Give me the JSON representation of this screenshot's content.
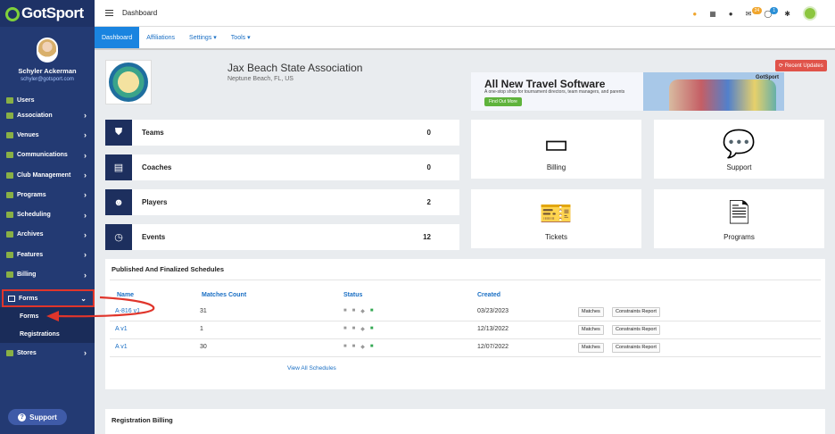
{
  "app": {
    "logo": "GotSport"
  },
  "user": {
    "name": "Schyler Ackerman",
    "email": "schyler@gotsport.com"
  },
  "sidebar": {
    "items": [
      {
        "label": "Users",
        "icon": "users-icon"
      },
      {
        "label": "Association",
        "icon": "sitemap-icon"
      },
      {
        "label": "Venues",
        "icon": "map-icon"
      },
      {
        "label": "Communications",
        "icon": "chat-icon"
      },
      {
        "label": "Club Management",
        "icon": "club-icon"
      },
      {
        "label": "Programs",
        "icon": "list-icon"
      },
      {
        "label": "Scheduling",
        "icon": "calendar-icon"
      },
      {
        "label": "Archives",
        "icon": "archive-icon"
      },
      {
        "label": "Features",
        "icon": "star-icon"
      },
      {
        "label": "Billing",
        "icon": "credit-card-icon"
      }
    ],
    "forms": {
      "label": "Forms",
      "sub": [
        "Forms",
        "Registrations"
      ]
    },
    "stores": {
      "label": "Stores"
    },
    "support": "Support"
  },
  "topbar": {
    "title": "Dashboard",
    "mail_count": "24",
    "chat_count": "1"
  },
  "subnav": {
    "tabs": [
      "Dashboard",
      "Affiliations",
      "Settings ▾",
      "Tools ▾"
    ]
  },
  "org": {
    "name": "Jax Beach State Association",
    "location": "Neptune Beach, FL, US",
    "updates_btn": "⟳ Recent Updates"
  },
  "banner": {
    "title": "All New Travel Software",
    "subtitle": "A one-stop shop for tournament directors, team managers, and parents",
    "button": "Find Out More",
    "logo": "GotSport"
  },
  "stats": [
    {
      "label": "Teams",
      "value": "0"
    },
    {
      "label": "Coaches",
      "value": "0"
    },
    {
      "label": "Players",
      "value": "2"
    },
    {
      "label": "Events",
      "value": "12"
    }
  ],
  "tiles": [
    {
      "label": "Billing"
    },
    {
      "label": "Support"
    },
    {
      "label": "Tickets"
    },
    {
      "label": "Programs"
    }
  ],
  "schedules": {
    "title": "Published And Finalized Schedules",
    "headers": [
      "Name",
      "Matches Count",
      "Status",
      "Created"
    ],
    "rows": [
      {
        "name": "A-816 v1",
        "count": "31",
        "created": "03/23/2023"
      },
      {
        "name": "A v1",
        "count": "1",
        "created": "12/13/2022"
      },
      {
        "name": "A v1",
        "count": "30",
        "created": "12/07/2022"
      }
    ],
    "btn_matches": "Matches",
    "btn_constraints": "Constraints Report",
    "view_all": "View All Schedules"
  },
  "registration": {
    "title": "Registration Billing"
  }
}
